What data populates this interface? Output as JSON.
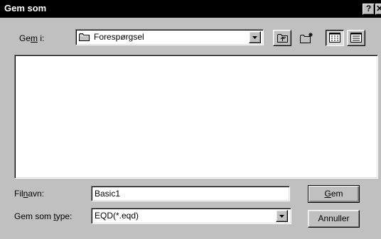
{
  "window": {
    "title": "Gem som",
    "help_glyph": "?",
    "close_glyph": "✕"
  },
  "lookin": {
    "label_before": "Ge",
    "label_accel": "m",
    "label_after": " i:",
    "value": "Forespørgsel",
    "icon": "folder-icon"
  },
  "toolbar": {
    "icons": [
      "up-one-level-icon",
      "new-folder-icon",
      "list-view-icon",
      "details-view-icon"
    ]
  },
  "filename": {
    "label_before": "Fil",
    "label_accel": "n",
    "label_after": "avn:",
    "value": "Basic1"
  },
  "filetype": {
    "label_before": "Gem som ",
    "label_accel": "t",
    "label_after": "ype:",
    "value": "EQD(*.eqd)"
  },
  "buttons": {
    "save_accel": "G",
    "save_rest": "em",
    "cancel": "Annuller"
  },
  "colors": {
    "face": "#c0c0c0",
    "title_bar": "#000000"
  }
}
